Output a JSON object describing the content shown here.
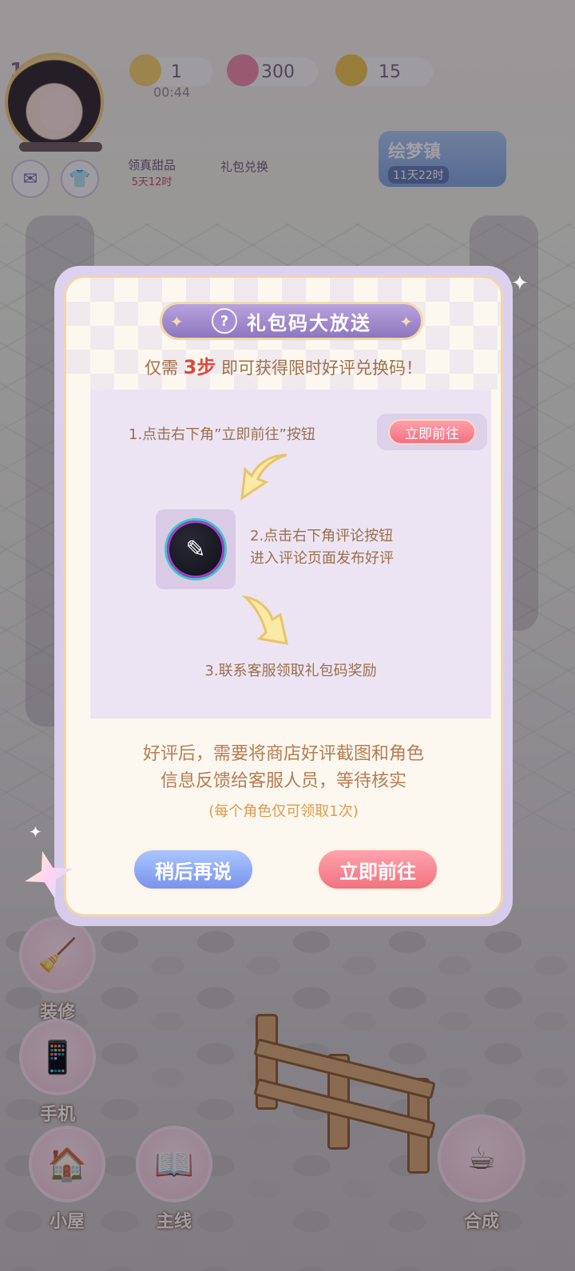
{
  "hud": {
    "level": "12",
    "energy": "1",
    "energy_timer": "00:44",
    "gems": "300",
    "coins": "15",
    "icons": [
      {
        "label": "领真甜品",
        "sub": "5天12时"
      },
      {
        "label": "礼包兑换",
        "sub": ""
      }
    ],
    "town_button": {
      "title": "绘梦镇",
      "timer": "11天22时"
    }
  },
  "dialog": {
    "title": "礼包码大放送",
    "subtitle_pre": "仅需 ",
    "subtitle_num": "3步",
    "subtitle_post": " 即可获得限时好评兑换码！",
    "step1": "1.点击右下角”立即前往”按钮",
    "step1_chip": "立即前往",
    "step2_line1": "2.点击右下角评论按钮",
    "step2_line2": "进入评论页面发布好评",
    "step3": "3.联系客服领取礼包码奖励",
    "note_line1": "好评后，需要将商店好评截图和角色",
    "note_line2": "信息反馈给客服人员，等待核实",
    "note_small": "(每个角色仅可领取1次)",
    "button_later": "稍后再说",
    "button_go": "立即前往"
  },
  "bottom": {
    "decorate": "装修",
    "phone": "手机",
    "house": "小屋",
    "main_line": "主线",
    "synthesize": "合成"
  },
  "icons": [
    "mail-icon",
    "wardrobe-icon",
    "question-icon",
    "pen-icon",
    "arrow-down-left-icon",
    "arrow-down-right-icon"
  ],
  "colors": {
    "accent_purple": "#8d76bd",
    "go_button": "#f0737f",
    "later_button": "#7a93ec",
    "highlight_red": "#e2463a",
    "text_brown": "#9a6f4d"
  }
}
